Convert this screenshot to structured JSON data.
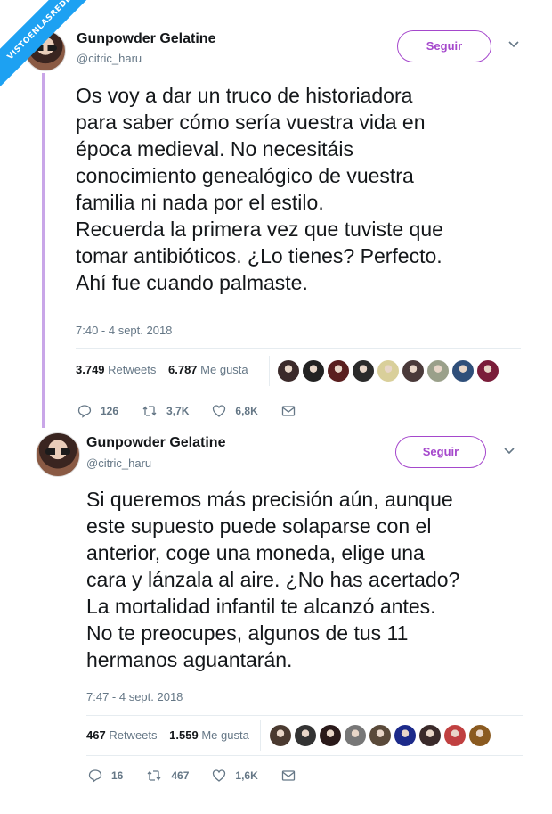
{
  "watermark": "VISTOENLASREDES",
  "colors": {
    "accent": "#a548cc",
    "thread": "#c9a6e8",
    "muted": "#657786",
    "text": "#14171a"
  },
  "tweets": [
    {
      "name": "Gunpowder Gelatine",
      "handle": "@citric_haru",
      "follow_label": "Seguir",
      "text": "Os voy a dar un truco de historiadora\npara saber cómo sería vuestra vida en\népoca medieval. No necesitáis\nconocimiento genealógico de vuestra\nfamilia ni nada por el estilo.\nRecuerda la primera vez que tuviste que\ntomar antibióticos. ¿Lo tienes? Perfecto.\nAhí fue cuando palmaste.",
      "timestamp": "7:40 - 4 sept. 2018",
      "retweets_count": "3.749",
      "retweets_label": "Retweets",
      "likes_count": "6.787",
      "likes_label": "Me gusta",
      "replies": "126",
      "rts": "3,7K",
      "likes": "6,8K",
      "liker_colors": [
        "#3b2a2a",
        "#222222",
        "#5a1f1f",
        "#2b2b2b",
        "#d9cf9a",
        "#4a3a3a",
        "#9aa08a",
        "#2f4f7a",
        "#7a1d3a"
      ]
    },
    {
      "name": "Gunpowder Gelatine",
      "handle": "@citric_haru",
      "follow_label": "Seguir",
      "text": "Si queremos más precisión aún, aunque\neste supuesto puede solaparse con el\nanterior, coge una moneda, elige una\ncara y lánzala al aire. ¿No has acertado?\nLa mortalidad infantil te alcanzó antes.\nNo te preocupes, algunos de tus 11\nhermanos aguantarán.",
      "timestamp": "7:47 - 4 sept. 2018",
      "retweets_count": "467",
      "retweets_label": "Retweets",
      "likes_count": "1.559",
      "likes_label": "Me gusta",
      "replies": "16",
      "rts": "467",
      "likes": "1,6K",
      "liker_colors": [
        "#4a3a30",
        "#333333",
        "#2a1a1a",
        "#777777",
        "#5a4a3a",
        "#1c2a8a",
        "#3a2a2a",
        "#c04040",
        "#8a5a20"
      ]
    }
  ]
}
